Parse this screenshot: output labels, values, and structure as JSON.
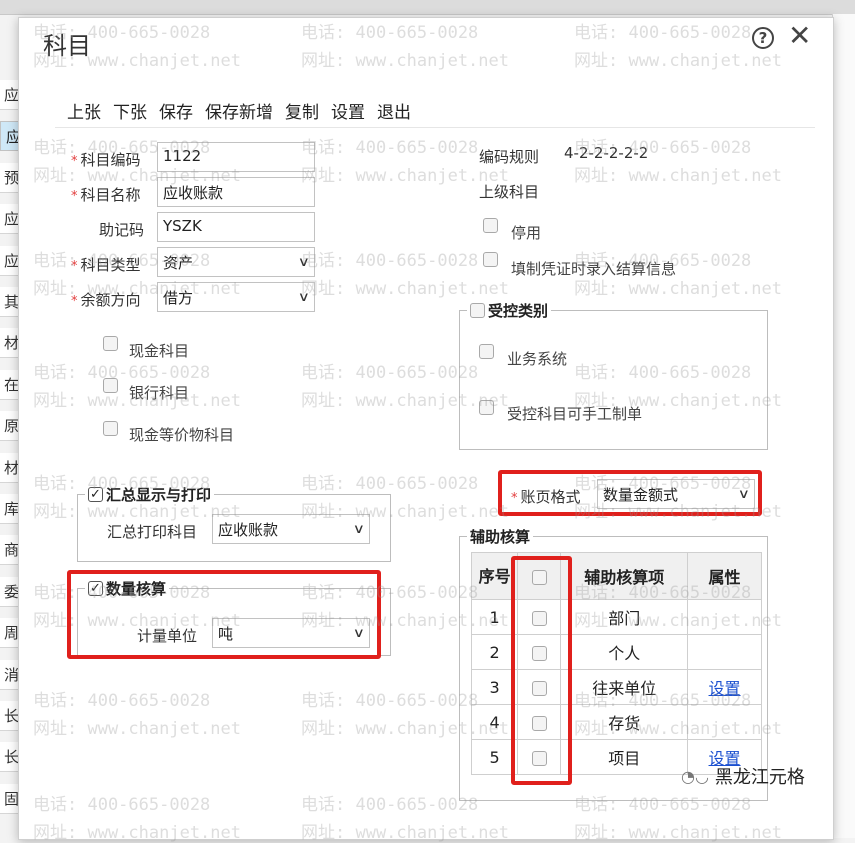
{
  "background": {
    "rows": [
      "应",
      "应",
      "预",
      "应",
      "应",
      "其",
      "材",
      "在",
      "原",
      "材",
      "库",
      "商",
      "委",
      "周",
      "消",
      "长",
      "长",
      "固"
    ]
  },
  "modal": {
    "title": "科目",
    "toolbar": [
      "上张",
      "下张",
      "保存",
      "保存新增",
      "复制",
      "设置",
      "退出"
    ],
    "left": {
      "code_label": "科目编码",
      "code_value": "1122",
      "name_label": "科目名称",
      "name_value": "应收账款",
      "mnemonic_label": "助记码",
      "mnemonic_value": "YSZK",
      "type_label": "科目类型",
      "type_value": "资产",
      "balance_label": "余额方向",
      "balance_value": "借方",
      "cash_label": "现金科目",
      "bank_label": "银行科目",
      "cash_equiv_label": "现金等价物科目"
    },
    "right": {
      "code_rule_label": "编码规则",
      "code_rule_value": "4-2-2-2-2-2",
      "parent_label": "上级科目",
      "disabled_label": "停用",
      "settle_label": "填制凭证时录入结算信息"
    },
    "controlled": {
      "legend": "受控类别",
      "business_label": "业务系统",
      "manual_label": "受控科目可手工制单"
    },
    "summary": {
      "legend": "汇总显示与打印",
      "print_label": "汇总打印科目",
      "print_value": "应收账款"
    },
    "quantity": {
      "legend": "数量核算",
      "unit_label": "计量单位",
      "unit_value": "吨"
    },
    "page_format": {
      "label": "账页格式",
      "value": "数量金额式"
    },
    "aux": {
      "legend": "辅助核算",
      "headers": [
        "序号",
        "辅助核算项",
        "属性"
      ],
      "rows": [
        {
          "no": "1",
          "name": "部门",
          "attr": ""
        },
        {
          "no": "2",
          "name": "个人",
          "attr": ""
        },
        {
          "no": "3",
          "name": "往来单位",
          "attr": "设置"
        },
        {
          "no": "4",
          "name": "存货",
          "attr": ""
        },
        {
          "no": "5",
          "name": "项目",
          "attr": "设置"
        }
      ]
    },
    "watermark": {
      "phone": "电话: 400-665-0028",
      "site": "网址: www.chanjet.net",
      "brand": "黑龙江元格"
    }
  },
  "colors": {
    "highlight": "#e0201c",
    "link": "#1a4fd0",
    "required": "#e23c3c"
  }
}
